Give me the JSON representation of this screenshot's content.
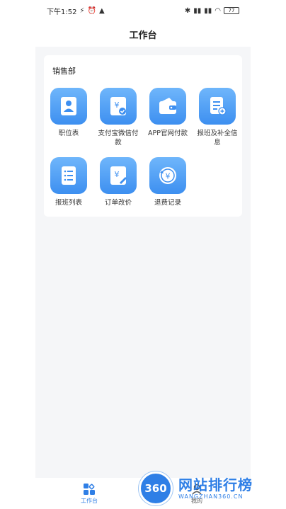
{
  "status_bar": {
    "time": "下午1:52",
    "battery": "77"
  },
  "nav": {
    "title": "工作台"
  },
  "section": {
    "title": "销售部",
    "items": [
      {
        "label": "职位表",
        "icon": "person-icon"
      },
      {
        "label": "支付宝微信付款",
        "icon": "yuan-check-icon"
      },
      {
        "label": "APP官网付款",
        "icon": "wallet-icon"
      },
      {
        "label": "报班及补全信息",
        "icon": "document-add-icon"
      },
      {
        "label": "报班列表",
        "icon": "list-icon"
      },
      {
        "label": "订单改价",
        "icon": "yuan-edit-icon"
      },
      {
        "label": "退费记录",
        "icon": "yuan-refund-icon"
      }
    ]
  },
  "tabbar": {
    "tabs": [
      {
        "label": "工作台",
        "icon": "grid-icon",
        "active": true
      },
      {
        "label": "我的",
        "icon": "user-icon",
        "active": false
      }
    ]
  },
  "watermark": {
    "cn": "网站排行榜",
    "en": "WANGZHAN360.CN",
    "badge": "360"
  },
  "colors": {
    "accent": "#2f7fe6",
    "tile_top": "#6fb6fb",
    "tile_bottom": "#3d8ff0",
    "background": "#f5f6f8"
  }
}
